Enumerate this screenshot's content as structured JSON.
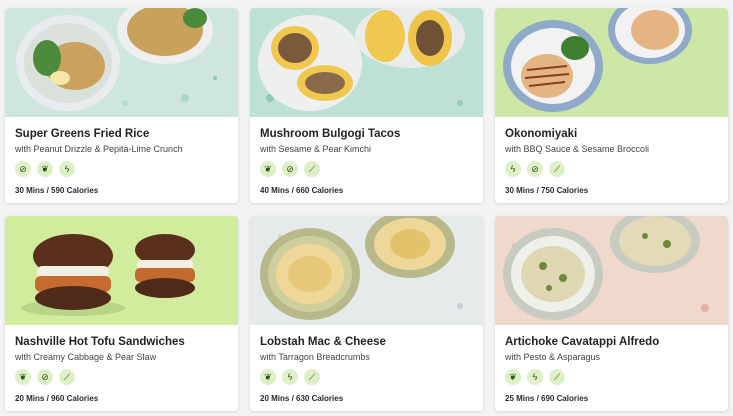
{
  "recipes": [
    {
      "title": "Super Greens Fried Rice",
      "subtitle": "with Peanut Drizzle & Pepita-Lime Crunch",
      "meta": "30 Mins / 590 Calories",
      "icons": [
        "no-gluten-icon",
        "leaf-swirl-icon",
        "bolt-icon"
      ],
      "bg": "#cfe6de"
    },
    {
      "title": "Mushroom Bulgogi Tacos",
      "subtitle": "with Sesame & Pear Kimchi",
      "meta": "40 Mins / 660 Calories",
      "icons": [
        "leaf-swirl-icon",
        "no-gluten-icon",
        "pepper-icon"
      ],
      "bg": "#bfe0d4"
    },
    {
      "title": "Okonomiyaki",
      "subtitle": "with BBQ Sauce & Sesame Broccoli",
      "meta": "30 Mins / 750 Calories",
      "icons": [
        "bolt-icon",
        "no-gluten-icon",
        "pepper-icon"
      ],
      "bg": "#cde8a6"
    },
    {
      "title": "Nashville Hot Tofu Sandwiches",
      "subtitle": "with Creamy Cabbage & Pear Slaw",
      "meta": "20 Mins / 960 Calories",
      "icons": [
        "leaf-swirl-icon",
        "no-gluten-icon",
        "pepper-icon"
      ],
      "bg": "#d1ec9c"
    },
    {
      "title": "Lobstah Mac & Cheese",
      "subtitle": "with Tarragon Breadcrumbs",
      "meta": "20 Mins / 630 Calories",
      "icons": [
        "leaf-swirl-icon",
        "bolt-icon",
        "pepper-icon"
      ],
      "bg": "#e7eaeb"
    },
    {
      "title": "Artichoke Cavatappi Alfredo",
      "subtitle": "with Pesto & Asparagus",
      "meta": "25 Mins / 690 Calories",
      "icons": [
        "leaf-swirl-icon",
        "bolt-icon",
        "pepper-icon"
      ],
      "bg": "#efd8cc"
    }
  ]
}
